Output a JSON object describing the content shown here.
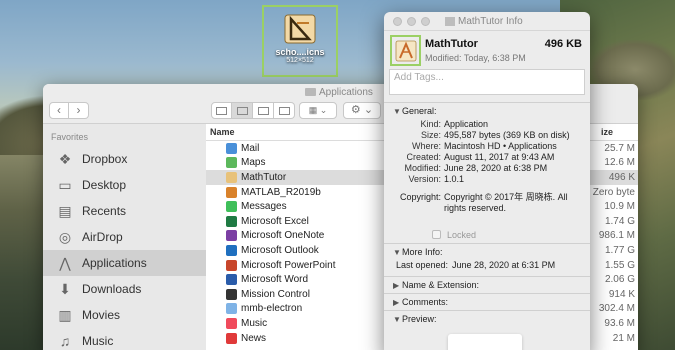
{
  "desktop_icon": {
    "name": "scho....icns",
    "dims": "512×512"
  },
  "finder": {
    "title": "Applications",
    "nav": {
      "back": "‹",
      "forward": "›"
    },
    "sidebar": {
      "heading": "Favorites",
      "items": [
        {
          "label": "Dropbox",
          "icon": "dropbox-icon"
        },
        {
          "label": "Desktop",
          "icon": "desktop-icon"
        },
        {
          "label": "Recents",
          "icon": "recents-icon"
        },
        {
          "label": "AirDrop",
          "icon": "airdrop-icon"
        },
        {
          "label": "Applications",
          "icon": "applications-icon"
        },
        {
          "label": "Downloads",
          "icon": "downloads-icon"
        },
        {
          "label": "Movies",
          "icon": "movies-icon"
        },
        {
          "label": "Music",
          "icon": "music-icon"
        }
      ]
    },
    "columns": {
      "name": "Name",
      "size": "ize"
    },
    "files": [
      {
        "name": "Mail",
        "size": "25.7 M",
        "color": "#4a90d9"
      },
      {
        "name": "Maps",
        "size": "12.6 M",
        "color": "#5cb85c"
      },
      {
        "name": "MathTutor",
        "size": "496 K",
        "color": "#e8c27a"
      },
      {
        "name": "MATLAB_R2019b",
        "size": "Zero byte",
        "color": "#d9822b"
      },
      {
        "name": "Messages",
        "size": "10.9 M",
        "color": "#3fbf5a"
      },
      {
        "name": "Microsoft Excel",
        "size": "1.74 G",
        "color": "#1f7a43"
      },
      {
        "name": "Microsoft OneNote",
        "size": "986.1 M",
        "color": "#7b3fa3"
      },
      {
        "name": "Microsoft Outlook",
        "size": "1.77 G",
        "color": "#1f6fbf"
      },
      {
        "name": "Microsoft PowerPoint",
        "size": "1.55 G",
        "color": "#c8462b"
      },
      {
        "name": "Microsoft Word",
        "size": "2.06 G",
        "color": "#2a5caa"
      },
      {
        "name": "Mission Control",
        "size": "914 K",
        "color": "#333333"
      },
      {
        "name": "mmb-electron",
        "size": "302.4 M",
        "color": "#7fb3e6"
      },
      {
        "name": "Music",
        "size": "93.6 M",
        "color": "#f04a5c"
      },
      {
        "name": "News",
        "size": "21 M",
        "color": "#e03a3a"
      }
    ]
  },
  "info": {
    "title": "MathTutor Info",
    "name": "MathTutor",
    "size": "496 KB",
    "modified": "Modified: Today, 6:38 PM",
    "tags_placeholder": "Add Tags...",
    "general": {
      "heading": "General:",
      "rows": [
        {
          "k": "Kind:",
          "v": "Application"
        },
        {
          "k": "Size:",
          "v": "495,587 bytes (369 KB on disk)"
        },
        {
          "k": "Where:",
          "v": "Macintosh HD • Applications"
        },
        {
          "k": "Created:",
          "v": "August 11, 2017 at 9:43 AM"
        },
        {
          "k": "Modified:",
          "v": "June 28, 2020 at 6:38 PM"
        },
        {
          "k": "Version:",
          "v": "1.0.1"
        }
      ],
      "copyright_k": "Copyright:",
      "copyright_v": "Copyright © 2017年 周晓栋. All rights reserved.",
      "locked": "Locked"
    },
    "more_info": {
      "heading": "More Info:",
      "last_opened_k": "Last opened:",
      "last_opened_v": "June 28, 2020 at 6:31 PM"
    },
    "name_ext": "Name & Extension:",
    "comments": "Comments:",
    "preview": "Preview:"
  }
}
